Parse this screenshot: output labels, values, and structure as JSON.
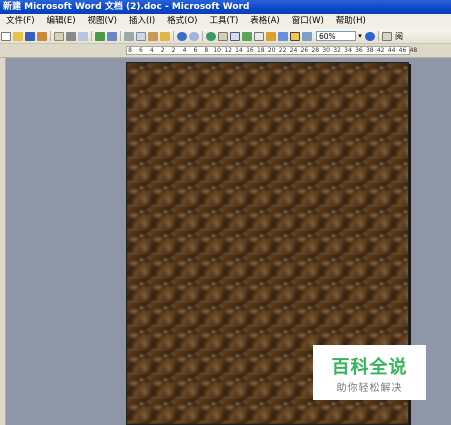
{
  "window": {
    "title": "新建 Microsoft Word 文档 (2).doc - Microsoft Word"
  },
  "menu": [
    "文件(F)",
    "编辑(E)",
    "视图(V)",
    "插入(I)",
    "格式(O)",
    "工具(T)",
    "表格(A)",
    "窗口(W)",
    "帮助(H)"
  ],
  "toolbar": {
    "zoom_value": "60%",
    "read_label": "阅",
    "button_icons": [
      "new-icon",
      "open-icon",
      "save-icon",
      "permission-icon",
      "email-icon",
      "print-icon",
      "print-preview-icon",
      "spelling-icon",
      "research-icon",
      "cut-icon",
      "copy-icon",
      "paste-icon",
      "format-painter-icon",
      "undo-icon",
      "redo-icon",
      "hyperlink-icon",
      "tables-borders-icon",
      "insert-table-icon",
      "insert-excel-icon",
      "columns-icon",
      "drawing-icon",
      "document-map-icon",
      "show-hide-icon",
      "zoom-dropdown",
      "help-icon",
      "read-icon"
    ]
  },
  "ruler": {
    "ticks": [
      "8",
      "6",
      "4",
      "2",
      "2",
      "4",
      "6",
      "8",
      "10",
      "12",
      "14",
      "16",
      "18",
      "20",
      "22",
      "24",
      "26",
      "28",
      "30",
      "32",
      "34",
      "36",
      "38",
      "42",
      "44",
      "46",
      "48"
    ]
  },
  "watermark": {
    "title": "百科全说",
    "subtitle": "助你轻松解决"
  },
  "colors": {
    "titlebar": "#0a47c8",
    "page_background": "#4a3118",
    "watermark_green": "#34b55a"
  }
}
